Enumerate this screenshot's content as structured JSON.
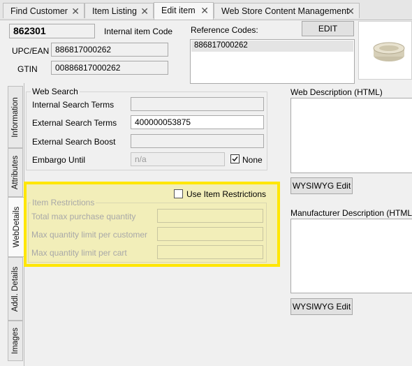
{
  "tabs": [
    {
      "label": "Find Customer",
      "close": "✕"
    },
    {
      "label": "Item Listing",
      "close": "✕"
    },
    {
      "label": "Edit item",
      "close": "✕"
    },
    {
      "label": "Web Store Content Management",
      "close": "✕"
    }
  ],
  "header": {
    "item_number": "862301",
    "internal_code_label": "Internal item Code",
    "upc_label": "UPC/EAN",
    "upc_value": "886817000262",
    "gtin_label": "GTIN",
    "gtin_value": "00886817000262",
    "reference_codes_label": "Reference Codes:",
    "edit_label": "EDIT",
    "reference_codes": [
      "886817000262"
    ]
  },
  "side_tabs": [
    "Information",
    "Attributes",
    "WebDetails",
    "Addl. Details",
    "Images"
  ],
  "web_search": {
    "title": "Web Search",
    "internal_label": "Internal Search Terms",
    "internal_value": "",
    "external_label": "External Search Terms",
    "external_value": "400000053875",
    "boost_label": "External Search Boost",
    "boost_value": "",
    "embargo_label": "Embargo Until",
    "embargo_value": "n/a",
    "none_label": "None",
    "none_checked": true
  },
  "restrictions": {
    "use_label": "Use Item Restrictions",
    "use_checked": false,
    "title": "Item Restrictions",
    "total_label": "Total max purchase quantity",
    "customer_label": "Max quantity limit per customer",
    "cart_label": "Max quantity limit per cart",
    "highlight_color": "#ffe600"
  },
  "descriptions": {
    "web_label": "Web Description (HTML)",
    "web_wysiwyg": "WYSIWYG Edit",
    "mfr_label": "Manufacturer Description (HTML)",
    "mfr_wysiwyg": "WYSIWYG Edit"
  },
  "icons": {
    "close": "close-icon",
    "check": "checkmark-icon",
    "product": "product-image"
  }
}
